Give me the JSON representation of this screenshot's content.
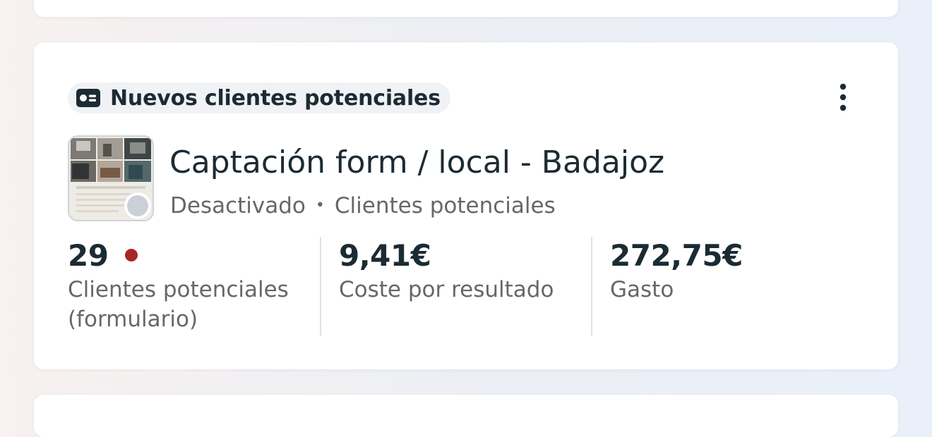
{
  "campaign_card": {
    "objective_label": "Nuevos clientes potenciales",
    "objective_icon": "lead-form-icon",
    "more_icon": "more-vertical-icon",
    "campaign_name": "Captación form / local - Badajoz",
    "status": "Desactivado",
    "separator": "•",
    "objective_type": "Clientes potenciales",
    "metrics": [
      {
        "value": "29",
        "label": "Clientes potenciales (formulario)",
        "alert": true
      },
      {
        "value": "9,41€",
        "label": "Coste por resultado"
      },
      {
        "value": "272,75€",
        "label": "Gasto"
      }
    ]
  },
  "colors": {
    "text_primary": "#1c2b33",
    "text_secondary": "#65676b",
    "alert_dot": "#a82626",
    "status_inactive": "#cbd0d8",
    "pill_background": "#f0f2f5"
  }
}
